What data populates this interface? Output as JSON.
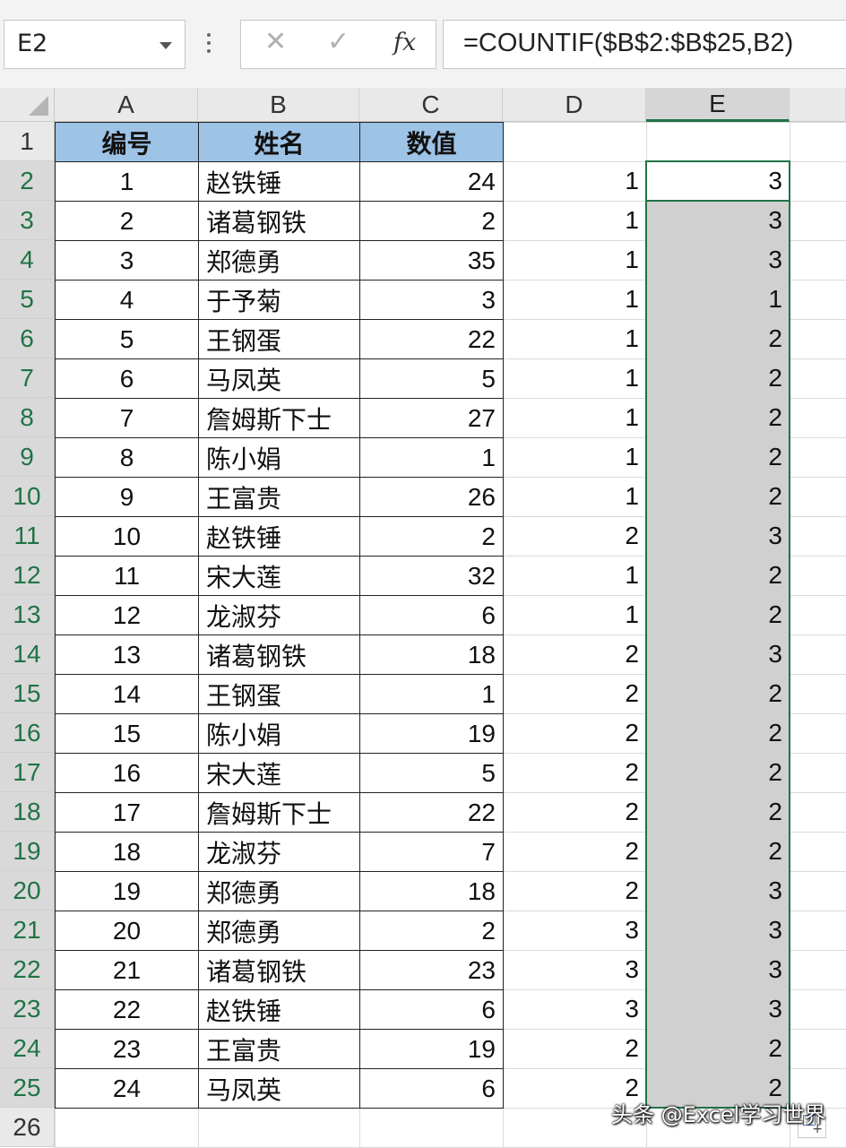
{
  "formula_bar": {
    "name_box": "E2",
    "cancel_glyph": "✕",
    "enter_glyph": "✓",
    "fx_label": "fx",
    "formula": "=COUNTIF($B$2:$B$25,B2)"
  },
  "columns": [
    "A",
    "B",
    "C",
    "D",
    "E"
  ],
  "selected_column": "E",
  "active_cell": "E2",
  "header_row": {
    "row": "1",
    "a": "编号",
    "b": "姓名",
    "c": "数值",
    "d": "",
    "e": ""
  },
  "rows": [
    {
      "row": "2",
      "a": "1",
      "b": "赵铁锤",
      "c": "24",
      "d": "1",
      "e": "3"
    },
    {
      "row": "3",
      "a": "2",
      "b": "诸葛钢铁",
      "c": "2",
      "d": "1",
      "e": "3"
    },
    {
      "row": "4",
      "a": "3",
      "b": "郑德勇",
      "c": "35",
      "d": "1",
      "e": "3"
    },
    {
      "row": "5",
      "a": "4",
      "b": "于予菊",
      "c": "3",
      "d": "1",
      "e": "1"
    },
    {
      "row": "6",
      "a": "5",
      "b": "王钢蛋",
      "c": "22",
      "d": "1",
      "e": "2"
    },
    {
      "row": "7",
      "a": "6",
      "b": "马凤英",
      "c": "5",
      "d": "1",
      "e": "2"
    },
    {
      "row": "8",
      "a": "7",
      "b": "詹姆斯下士",
      "c": "27",
      "d": "1",
      "e": "2"
    },
    {
      "row": "9",
      "a": "8",
      "b": "陈小娟",
      "c": "1",
      "d": "1",
      "e": "2"
    },
    {
      "row": "10",
      "a": "9",
      "b": "王富贵",
      "c": "26",
      "d": "1",
      "e": "2"
    },
    {
      "row": "11",
      "a": "10",
      "b": "赵铁锤",
      "c": "2",
      "d": "2",
      "e": "3"
    },
    {
      "row": "12",
      "a": "11",
      "b": "宋大莲",
      "c": "32",
      "d": "1",
      "e": "2"
    },
    {
      "row": "13",
      "a": "12",
      "b": "龙淑芬",
      "c": "6",
      "d": "1",
      "e": "2"
    },
    {
      "row": "14",
      "a": "13",
      "b": "诸葛钢铁",
      "c": "18",
      "d": "2",
      "e": "3"
    },
    {
      "row": "15",
      "a": "14",
      "b": "王钢蛋",
      "c": "1",
      "d": "2",
      "e": "2"
    },
    {
      "row": "16",
      "a": "15",
      "b": "陈小娟",
      "c": "19",
      "d": "2",
      "e": "2"
    },
    {
      "row": "17",
      "a": "16",
      "b": "宋大莲",
      "c": "5",
      "d": "2",
      "e": "2"
    },
    {
      "row": "18",
      "a": "17",
      "b": "詹姆斯下士",
      "c": "22",
      "d": "2",
      "e": "2"
    },
    {
      "row": "19",
      "a": "18",
      "b": "龙淑芬",
      "c": "7",
      "d": "2",
      "e": "2"
    },
    {
      "row": "20",
      "a": "19",
      "b": "郑德勇",
      "c": "18",
      "d": "2",
      "e": "3"
    },
    {
      "row": "21",
      "a": "20",
      "b": "郑德勇",
      "c": "2",
      "d": "3",
      "e": "3"
    },
    {
      "row": "22",
      "a": "21",
      "b": "诸葛钢铁",
      "c": "23",
      "d": "3",
      "e": "3"
    },
    {
      "row": "23",
      "a": "22",
      "b": "赵铁锤",
      "c": "6",
      "d": "3",
      "e": "3"
    },
    {
      "row": "24",
      "a": "23",
      "b": "王富贵",
      "c": "19",
      "d": "2",
      "e": "2"
    },
    {
      "row": "25",
      "a": "24",
      "b": "马凤英",
      "c": "6",
      "d": "2",
      "e": "2"
    }
  ],
  "last_row": "26",
  "watermark": "头条 @Excel学习世界",
  "colors": {
    "header_fill": "#9dc3e6",
    "selection_border": "#217346",
    "selection_shade": "#d0d0d0"
  }
}
